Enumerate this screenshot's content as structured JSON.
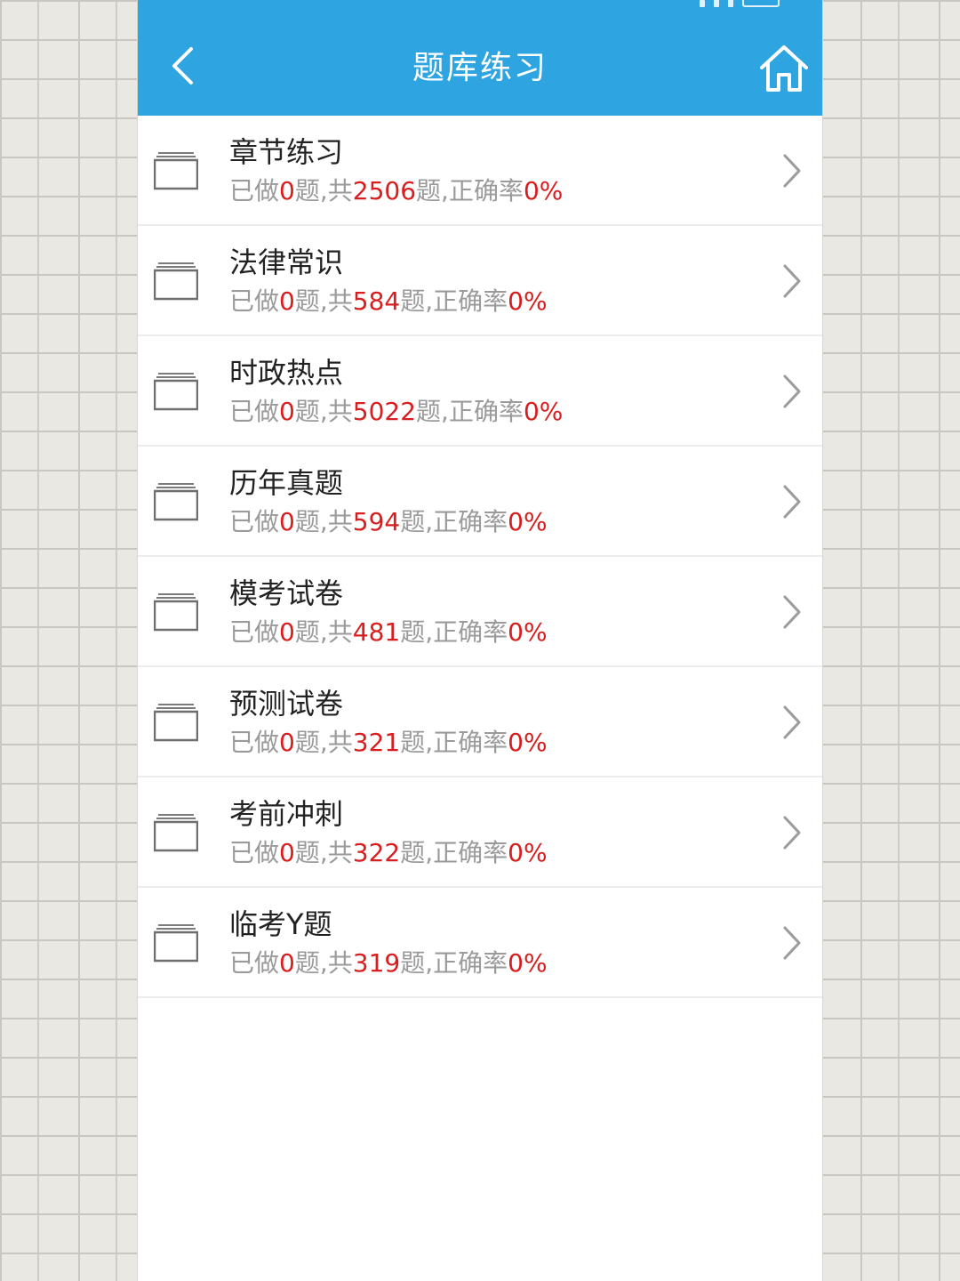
{
  "header": {
    "title": "题库练习",
    "color": "#2ea4e0"
  },
  "icons": {
    "back": "chevron-left-icon",
    "home": "home-icon",
    "row_leading": "book-icon",
    "row_trailing": "chevron-right-icon"
  },
  "stats_labels": {
    "done_prefix": "已做",
    "unit": "题",
    "total_prefix": ",共",
    "accuracy_prefix": ",正确率"
  },
  "items": [
    {
      "name": "章节练习",
      "done": "0",
      "total": "2506",
      "accuracy": "0%"
    },
    {
      "name": "法律常识",
      "done": "0",
      "total": "584",
      "accuracy": "0%"
    },
    {
      "name": "时政热点",
      "done": "0",
      "total": "5022",
      "accuracy": "0%"
    },
    {
      "name": "历年真题",
      "done": "0",
      "total": "594",
      "accuracy": "0%"
    },
    {
      "name": "模考试卷",
      "done": "0",
      "total": "481",
      "accuracy": "0%"
    },
    {
      "name": "预测试卷",
      "done": "0",
      "total": "321",
      "accuracy": "0%"
    },
    {
      "name": "考前冲刺",
      "done": "0",
      "total": "322",
      "accuracy": "0%"
    },
    {
      "name": "临考Y题",
      "done": "0",
      "total": "319",
      "accuracy": "0%"
    }
  ]
}
